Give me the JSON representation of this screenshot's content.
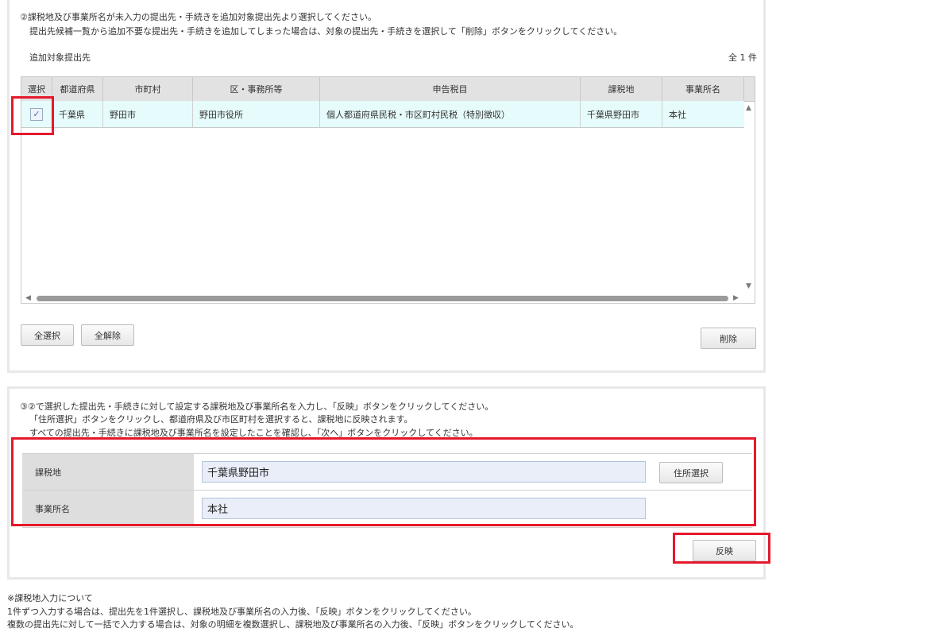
{
  "panel1": {
    "instruction_1": "②課税地及び事業所名が未入力の提出先・手続きを追加対象提出先より選択してください。",
    "instruction_2": "提出先候補一覧から追加不要な提出先・手続きを追加してしまった場合は、対象の提出先・手続きを選択して「削除」ボタンをクリックしてください。",
    "section_label": "追加対象提出先",
    "count_label": "全 1 件",
    "table": {
      "columns": [
        "選択",
        "都道府県",
        "市町村",
        "区・事務所等",
        "申告税目",
        "課税地",
        "事業所名"
      ],
      "rows": [
        {
          "checked": true,
          "check_glyph": "✓",
          "cells": [
            "千葉県",
            "野田市",
            "野田市役所",
            "個人都道府県民税・市区町村民税（特別徴収）",
            "千葉県野田市",
            "本社"
          ]
        }
      ]
    },
    "select_all_label": "全選択",
    "deselect_all_label": "全解除",
    "delete_label": "削除"
  },
  "panel2": {
    "instruction_1": "③②で選択した提出先・手続きに対して設定する課税地及び事業所名を入力し、「反映」ボタンをクリックしてください。",
    "instruction_2": "「住所選択」ボタンをクリックし、都道府県及び市区町村を選択すると、課税地に反映されます。",
    "instruction_3": "すべての提出先・手続きに課税地及び事業所名を設定したことを確認し、「次へ」ボタンをクリックしてください。",
    "form": {
      "tax_place_label": "課税地",
      "tax_place_value": "千葉県野田市",
      "office_label": "事業所名",
      "office_value": "本社",
      "address_select_label": "住所選択"
    },
    "apply_label": "反映"
  },
  "notes": [
    "※課税地入力について",
    "1件ずつ入力する場合は、提出先を1件選択し、課税地及び事業所名の入力後、「反映」ボタンをクリックしてください。",
    "複数の提出先に対して一括で入力する場合は、対象の明細を複数選択し、課税地及び事業所名の入力後、「反映」ボタンをクリックしてください。"
  ],
  "colors": {
    "highlight": "#e5192b",
    "row_bg": "#e6fbfb",
    "header_bg": "#e2e2e2",
    "input_bg": "#e9eef9"
  },
  "icons": {
    "checkbox": "check-icon",
    "scroll": [
      "scroll-up-icon",
      "scroll-down-icon",
      "scroll-left-icon",
      "scroll-right-icon"
    ]
  }
}
